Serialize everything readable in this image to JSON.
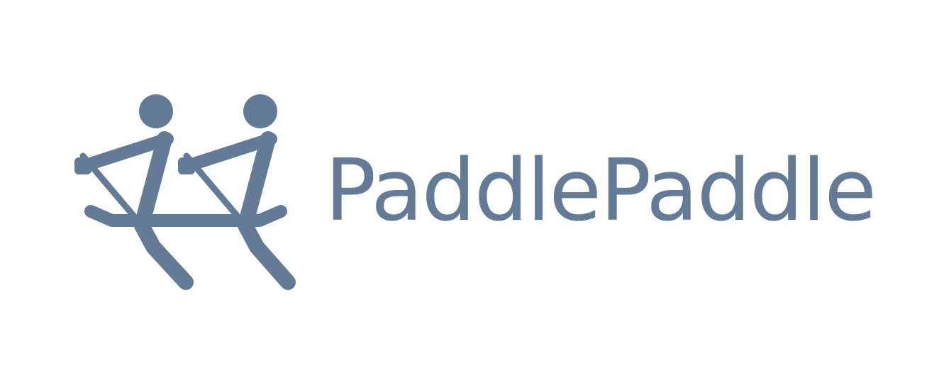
{
  "brand": {
    "name": "PaddlePaddle",
    "color": "#637b96",
    "background": "#ffffff"
  },
  "logo": {
    "icon": "two-rowers-paddling-icon"
  }
}
